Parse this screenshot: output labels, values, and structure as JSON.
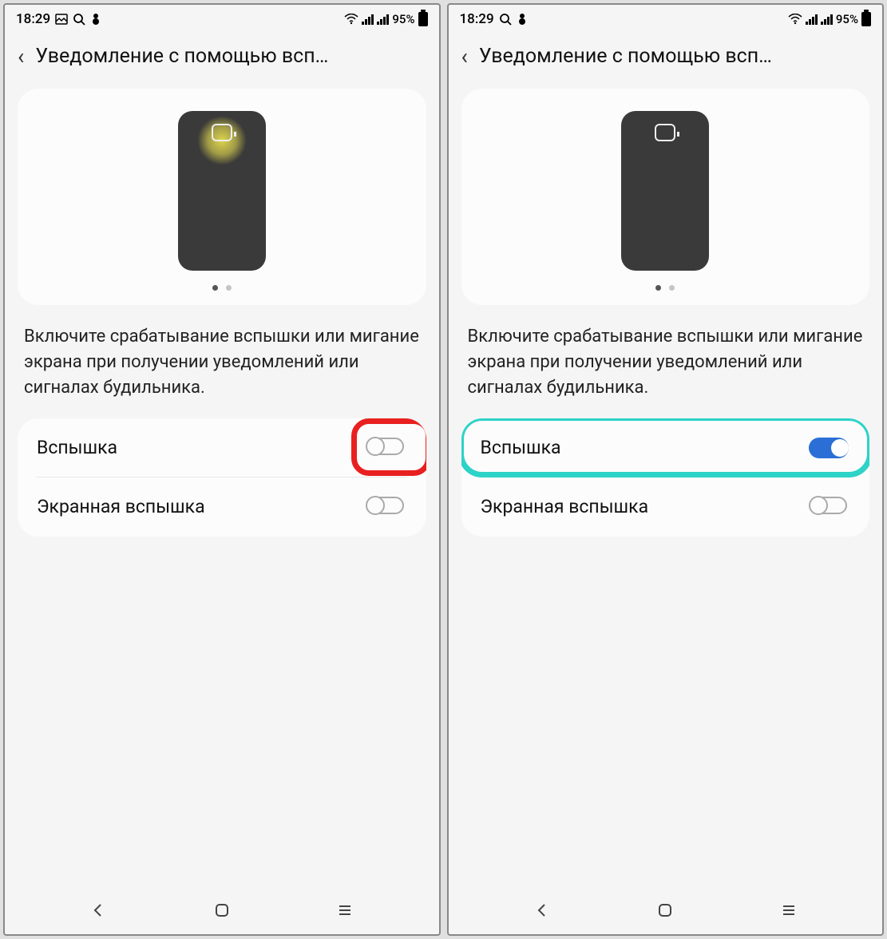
{
  "screens": [
    {
      "status": {
        "time": "18:29",
        "battery_pct": "95%"
      },
      "header": {
        "title": "Уведомление с помощью всп…"
      },
      "flash_glow": true,
      "description": "Включите срабатывание вспышки или мигание экрана при получении уведомлений или сигналах будильника.",
      "options": [
        {
          "label": "Вспышка",
          "on": false
        },
        {
          "label": "Экранная вспышка",
          "on": false
        }
      ],
      "highlight": {
        "type": "red",
        "target": "flash-toggle"
      }
    },
    {
      "status": {
        "time": "18:29",
        "battery_pct": "95%"
      },
      "header": {
        "title": "Уведомление с помощью всп…"
      },
      "flash_glow": false,
      "description": "Включите срабатывание вспышки или мигание экрана при получении уведомлений или сигналах будильника.",
      "options": [
        {
          "label": "Вспышка",
          "on": true
        },
        {
          "label": "Экранная вспышка",
          "on": false
        }
      ],
      "highlight": {
        "type": "teal",
        "target": "flash-row"
      }
    }
  ]
}
